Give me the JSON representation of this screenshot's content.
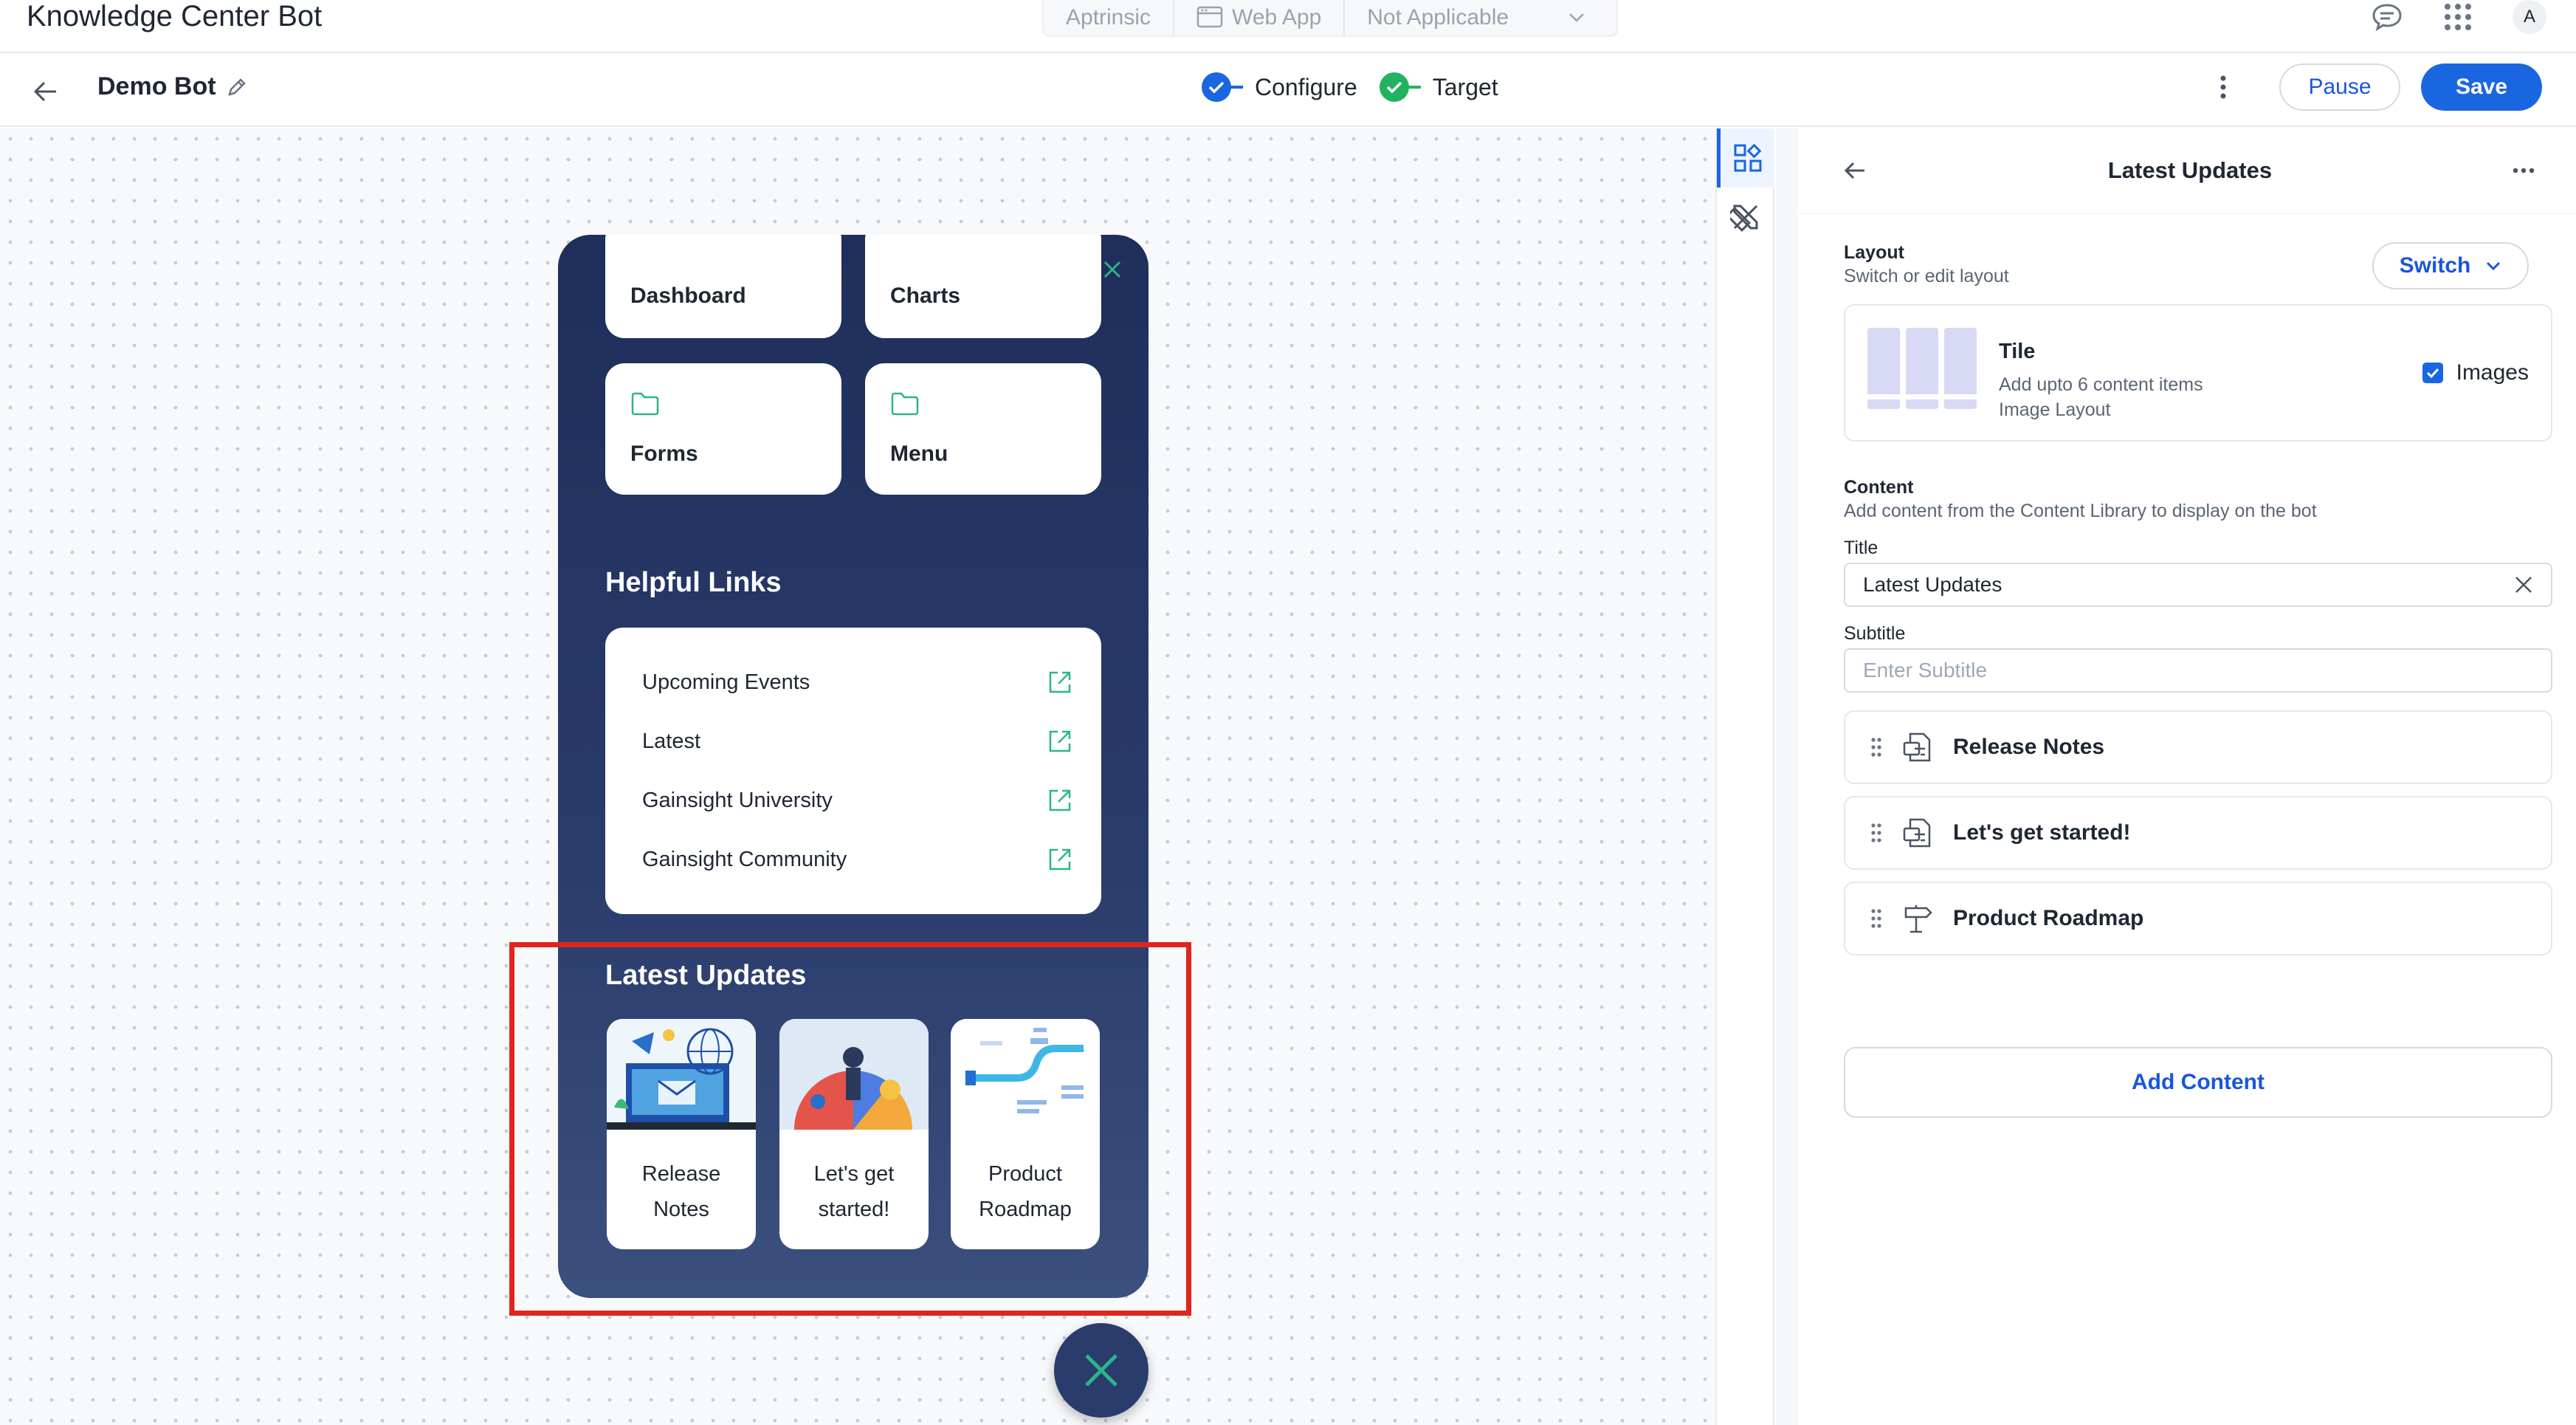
{
  "app": {
    "title": "Knowledge Center Bot"
  },
  "context": {
    "account": "Aptrinsic",
    "product": "Web App",
    "environment": "Not Applicable"
  },
  "user": {
    "initial": "A"
  },
  "header": {
    "bot_name": "Demo Bot",
    "steps": [
      {
        "label": "Configure",
        "status": "complete",
        "color": "#1a66e0"
      },
      {
        "label": "Target",
        "status": "complete",
        "color": "#22b35e"
      }
    ],
    "pause_label": "Pause",
    "save_label": "Save"
  },
  "bot": {
    "tiles": [
      {
        "label": "Dashboard"
      },
      {
        "label": "Charts"
      },
      {
        "label": "Forms",
        "icon": "folder-icon"
      },
      {
        "label": "Menu",
        "icon": "folder-icon"
      }
    ],
    "helpful_links": {
      "title": "Helpful Links",
      "items": [
        {
          "label": "Upcoming Events"
        },
        {
          "label": "Latest"
        },
        {
          "label": "Gainsight University"
        },
        {
          "label": "Gainsight Community"
        }
      ]
    },
    "latest_updates": {
      "title": "Latest Updates",
      "items": [
        {
          "line1": "Release",
          "line2": "Notes"
        },
        {
          "line1": "Let's get",
          "line2": "started!"
        },
        {
          "line1": "Product",
          "line2": "Roadmap"
        }
      ]
    }
  },
  "panel": {
    "title": "Latest Updates",
    "layout": {
      "label": "Layout",
      "sublabel": "Switch or edit layout",
      "switch_label": "Switch",
      "name": "Tile",
      "desc1": "Add upto 6 content items",
      "desc2": "Image Layout",
      "images_label": "Images",
      "images_checked": true
    },
    "content": {
      "label": "Content",
      "sublabel": "Add content from the Content Library to display on the bot",
      "title_label": "Title",
      "title_value": "Latest Updates",
      "subtitle_label": "Subtitle",
      "subtitle_placeholder": "Enter Subtitle",
      "items": [
        {
          "label": "Release Notes",
          "icon": "document-icon"
        },
        {
          "label": "Let's get started!",
          "icon": "document-icon"
        },
        {
          "label": "Product Roadmap",
          "icon": "signpost-icon"
        }
      ],
      "add_label": "Add Content"
    }
  },
  "colors": {
    "accent": "#1a66e0",
    "bot_bg": "#1f2e5a",
    "link_icon": "#2bb58a",
    "highlight": "#e0261c"
  }
}
